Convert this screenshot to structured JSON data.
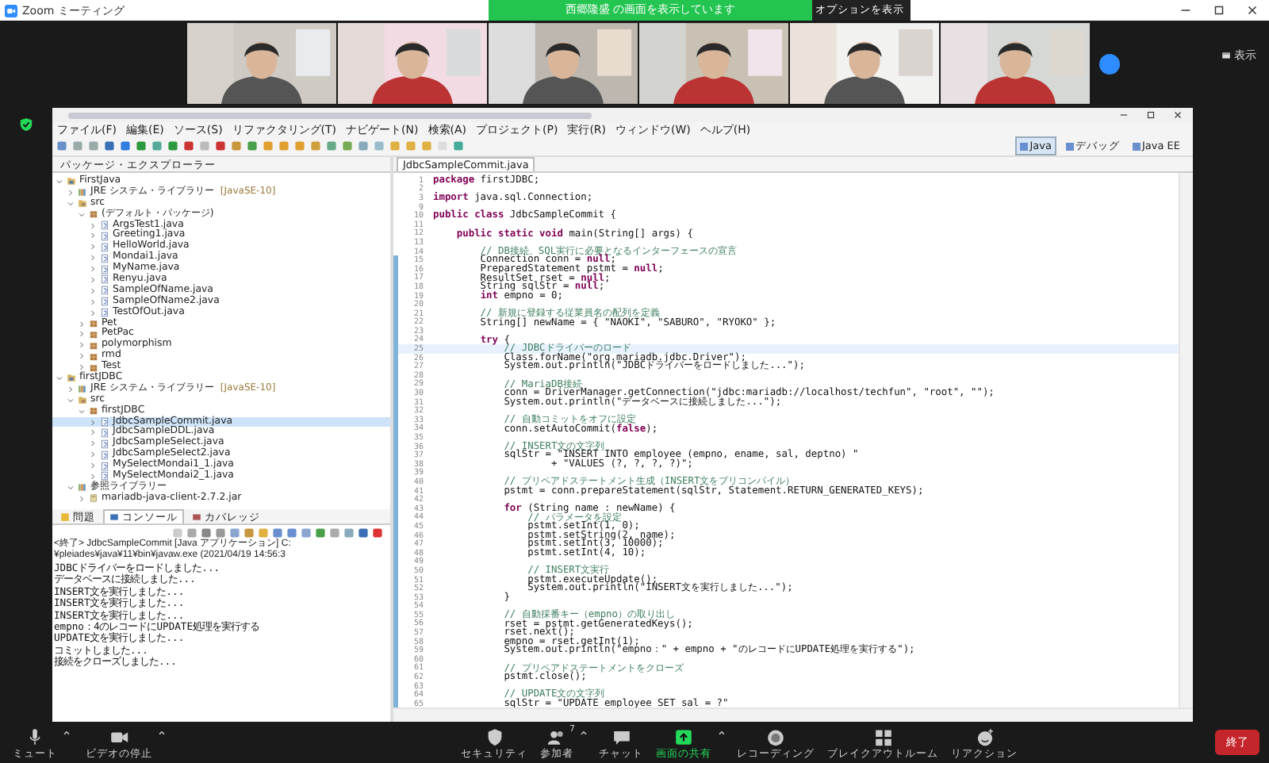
{
  "zoom_window": {
    "title": "Zoom ミーティング"
  },
  "share_banner": {
    "text": "西郷隆盛 の画面を表示しています",
    "options": "オプションを表示"
  },
  "view_button": "表示",
  "eclipse": {
    "menu": [
      "ファイル(F)",
      "編集(E)",
      "ソース(S)",
      "リファクタリング(T)",
      "ナビゲート(N)",
      "検索(A)",
      "プロジェクト(P)",
      "実行(R)",
      "ウィンドウ(W)",
      "ヘルプ(H)"
    ],
    "perspectives": [
      {
        "label": "Java",
        "selected": true
      },
      {
        "label": "デバッグ",
        "selected": false
      },
      {
        "label": "Java EE",
        "selected": false
      }
    ],
    "explorer": {
      "title": "パッケージ・エクスプローラー",
      "tree": [
        {
          "label": "FirstJava",
          "kind": "project",
          "expanded": true,
          "selected": false,
          "children": [
            {
              "label": "JRE システム・ライブラリー [JavaSE-10]",
              "kind": "library",
              "expanded": false,
              "selected": false
            },
            {
              "label": "src",
              "kind": "source",
              "expanded": true,
              "selected": false,
              "children": [
                {
                  "label": "(デフォルト・パッケージ)",
                  "kind": "package",
                  "expanded": true,
                  "selected": false,
                  "children": [
                    {
                      "label": "ArgsTest1.java",
                      "kind": "file",
                      "expanded": false,
                      "selected": false
                    },
                    {
                      "label": "Greeting1.java",
                      "kind": "file",
                      "expanded": false,
                      "selected": false
                    },
                    {
                      "label": "HelloWorld.java",
                      "kind": "file",
                      "expanded": false,
                      "selected": false
                    },
                    {
                      "label": "Mondai1.java",
                      "kind": "file",
                      "expanded": false,
                      "selected": false
                    },
                    {
                      "label": "MyName.java",
                      "kind": "file",
                      "expanded": false,
                      "selected": false
                    },
                    {
                      "label": "Renyu.java",
                      "kind": "file",
                      "expanded": false,
                      "selected": false
                    },
                    {
                      "label": "SampleOfName.java",
                      "kind": "file",
                      "expanded": false,
                      "selected": false
                    },
                    {
                      "label": "SampleOfName2.java",
                      "kind": "file",
                      "expanded": false,
                      "selected": false
                    },
                    {
                      "label": "TestOfOut.java",
                      "kind": "file",
                      "expanded": false,
                      "selected": false
                    }
                  ]
                },
                {
                  "label": "Pet",
                  "kind": "package",
                  "expanded": false,
                  "selected": false
                },
                {
                  "label": "PetPac",
                  "kind": "package",
                  "expanded": false,
                  "selected": false
                },
                {
                  "label": "polymorphism",
                  "kind": "package",
                  "expanded": false,
                  "selected": false
                },
                {
                  "label": "rmd",
                  "kind": "package",
                  "expanded": false,
                  "selected": false
                },
                {
                  "label": "Test",
                  "kind": "package",
                  "expanded": false,
                  "selected": false
                }
              ]
            }
          ]
        },
        {
          "label": "firstJDBC",
          "kind": "project",
          "expanded": true,
          "selected": false,
          "children": [
            {
              "label": "JRE システム・ライブラリー [JavaSE-10]",
              "kind": "library",
              "expanded": false,
              "selected": false
            },
            {
              "label": "src",
              "kind": "source",
              "expanded": true,
              "selected": false,
              "children": [
                {
                  "label": "firstJDBC",
                  "kind": "package",
                  "expanded": true,
                  "selected": false,
                  "children": [
                    {
                      "label": "JdbcSampleCommit.java",
                      "kind": "file",
                      "expanded": false,
                      "selected": true
                    },
                    {
                      "label": "JdbcSampleDDL.java",
                      "kind": "file",
                      "expanded": false,
                      "selected": false
                    },
                    {
                      "label": "JdbcSampleSelect.java",
                      "kind": "file",
                      "expanded": false,
                      "selected": false
                    },
                    {
                      "label": "JdbcSampleSelect2.java",
                      "kind": "file",
                      "expanded": false,
                      "selected": false
                    },
                    {
                      "label": "MySelectMondai1_1.java",
                      "kind": "file",
                      "expanded": false,
                      "selected": false
                    },
                    {
                      "label": "MySelectMondai2_1.java",
                      "kind": "file",
                      "expanded": false,
                      "selected": false
                    }
                  ]
                }
              ]
            },
            {
              "label": "参照ライブラリー",
              "kind": "library",
              "expanded": true,
              "selected": false,
              "children": [
                {
                  "label": "mariadb-java-client-2.7.2.jar",
                  "kind": "jar",
                  "expanded": false,
                  "selected": false
                }
              ]
            }
          ]
        }
      ]
    },
    "console": {
      "tabs": [
        {
          "label": "問題",
          "selected": false
        },
        {
          "label": "コンソール",
          "selected": true
        },
        {
          "label": "カバレッジ",
          "selected": false
        }
      ],
      "header": "<終了> JdbcSampleCommit [Java アプリケーション] C:¥pleiades¥java¥11¥bin¥javaw.exe (2021/04/19 14:56:3",
      "lines": [
        "JDBCドライバーをロードしました...",
        "データベースに接続しました...",
        "INSERT文を実行しました...",
        "INSERT文を実行しました...",
        "INSERT文を実行しました...",
        "empno：4のレコードにUPDATE処理を実行する",
        "UPDATE文を実行しました...",
        "コミットしました...",
        "接続をクローズしました..."
      ]
    },
    "editor": {
      "tab": "JdbcSampleCommit.java",
      "lines": [
        {
          "number": "1",
          "text": "**package** firstJDBC;",
          "kind": "code",
          "current": false
        },
        {
          "number": "2",
          "kind": "code",
          "current": false
        },
        {
          "number": "3",
          "text": "**import** java.sql.Connection;",
          "kind": "code",
          "current": false
        },
        {
          "number": "9",
          "kind": "code",
          "current": false
        },
        {
          "number": "10",
          "text": "**public class** JdbcSampleCommit {",
          "kind": "code",
          "current": false
        },
        {
          "number": "11",
          "kind": "code",
          "current": false
        },
        {
          "number": "12",
          "text": "    **public static void** main(String[] args) {",
          "kind": "code",
          "current": false
        },
        {
          "number": "13",
          "kind": "code",
          "current": false
        },
        {
          "number": "14",
          "text": "        // DB接続、SQL実行に必要となるインターフェースの宣言",
          "kind": "comment",
          "current": false
        },
        {
          "number": "15",
          "text": "        Connection conn = **null**;",
          "kind": "code",
          "current": false
        },
        {
          "number": "16",
          "text": "        PreparedStatement pstmt = **null**;",
          "kind": "code",
          "current": false
        },
        {
          "number": "17",
          "text": "        ResultSet rset = **null**;",
          "kind": "code",
          "current": false
        },
        {
          "number": "18",
          "text": "        String sqlStr = **null**;",
          "kind": "code",
          "current": false
        },
        {
          "number": "19",
          "text": "        **int** empno = 0;",
          "kind": "code",
          "current": false
        },
        {
          "number": "20",
          "kind": "code",
          "current": false
        },
        {
          "number": "21",
          "text": "        // 新規に登録する従業員名の配列を定義",
          "kind": "comment",
          "current": false
        },
        {
          "number": "22",
          "text": "        String[] newName = { \"NAOKI\", \"SABURO\", \"RYOKO\" };",
          "kind": "code",
          "current": false
        },
        {
          "number": "23",
          "kind": "code",
          "current": false
        },
        {
          "number": "24",
          "text": "        **try** {",
          "kind": "code",
          "current": false
        },
        {
          "number": "25",
          "text": "            // JDBCドライバーのロード",
          "kind": "comment",
          "current": true
        },
        {
          "number": "26",
          "text": "            Class.forName(\"org.mariadb.jdbc.Driver\");",
          "kind": "code",
          "current": false
        },
        {
          "number": "27",
          "text": "            System.out.println(\"JDBCドライバーをロードしました...\");",
          "kind": "code",
          "current": false
        },
        {
          "number": "28",
          "kind": "code",
          "current": false
        },
        {
          "number": "29",
          "text": "            // MariaDB接続",
          "kind": "comment",
          "current": false
        },
        {
          "number": "30",
          "text": "            conn = DriverManager.getConnection(\"jdbc:mariadb://localhost/techfun\", \"root\", \"\");",
          "kind": "code",
          "current": false
        },
        {
          "number": "31",
          "text": "            System.out.println(\"データベースに接続しました...\");",
          "kind": "code",
          "current": false
        },
        {
          "number": "32",
          "kind": "code",
          "current": false
        },
        {
          "number": "33",
          "text": "            // 自動コミットをオフに設定",
          "kind": "comment",
          "current": false
        },
        {
          "number": "34",
          "text": "            conn.setAutoCommit(**false**);",
          "kind": "code",
          "current": false
        },
        {
          "number": "35",
          "kind": "code",
          "current": false
        },
        {
          "number": "36",
          "text": "            // INSERT文の文字列",
          "kind": "comment",
          "current": false
        },
        {
          "number": "37",
          "text": "            sqlStr = \"INSERT INTO employee (empno, ename, sal, deptno) \"",
          "kind": "code",
          "current": false
        },
        {
          "number": "38",
          "text": "                    + \"VALUES (?, ?, ?, ?)\";",
          "kind": "code",
          "current": false
        },
        {
          "number": "39",
          "kind": "code",
          "current": false
        },
        {
          "number": "40",
          "text": "            // プリペアドステートメント生成（INSERT文をプリコンパイル）",
          "kind": "comment",
          "current": false
        },
        {
          "number": "41",
          "text": "            pstmt = conn.prepareStatement(sqlStr, Statement.RETURN_GENERATED_KEYS);",
          "kind": "code",
          "current": false
        },
        {
          "number": "42",
          "kind": "code",
          "current": false
        },
        {
          "number": "43",
          "text": "            **for** (String name : newName) {",
          "kind": "code",
          "current": false
        },
        {
          "number": "44",
          "text": "                // パラメータを設定",
          "kind": "comment",
          "current": false
        },
        {
          "number": "45",
          "text": "                pstmt.setInt(1, 0);",
          "kind": "code",
          "current": false
        },
        {
          "number": "46",
          "text": "                pstmt.setString(2, name);",
          "kind": "code",
          "current": false
        },
        {
          "number": "47",
          "text": "                pstmt.setInt(3, 10000);",
          "kind": "code",
          "current": false
        },
        {
          "number": "48",
          "text": "                pstmt.setInt(4, 10);",
          "kind": "code",
          "current": false
        },
        {
          "number": "49",
          "kind": "code",
          "current": false
        },
        {
          "number": "50",
          "text": "                // INSERT文実行",
          "kind": "comment",
          "current": false
        },
        {
          "number": "51",
          "text": "                pstmt.executeUpdate();",
          "kind": "code",
          "current": false
        },
        {
          "number": "52",
          "text": "                System.out.println(\"INSERT文を実行しました...\");",
          "kind": "code",
          "current": false
        },
        {
          "number": "53",
          "text": "            }",
          "kind": "code",
          "current": false
        },
        {
          "number": "54",
          "kind": "code",
          "current": false
        },
        {
          "number": "55",
          "text": "            // 自動採番キー（empno）の取り出し",
          "kind": "comment",
          "current": false
        },
        {
          "number": "56",
          "text": "            rset = pstmt.getGeneratedKeys();",
          "kind": "code",
          "current": false
        },
        {
          "number": "57",
          "text": "            rset.next();",
          "kind": "code",
          "current": false
        },
        {
          "number": "58",
          "text": "            empno = rset.getInt(1);",
          "kind": "code",
          "current": false
        },
        {
          "number": "59",
          "text": "            System.out.println(\"empno：\" + empno + \"のレコードにUPDATE処理を実行する\");",
          "kind": "code",
          "current": false
        },
        {
          "number": "60",
          "kind": "code",
          "current": false
        },
        {
          "number": "61",
          "text": "            // プリペアドステートメントをクローズ",
          "kind": "comment",
          "current": false
        },
        {
          "number": "62",
          "text": "            pstmt.close();",
          "kind": "code",
          "current": false
        },
        {
          "number": "63",
          "kind": "code",
          "current": false
        },
        {
          "number": "64",
          "text": "            // UPDATE文の文字列",
          "kind": "comment",
          "current": false
        },
        {
          "number": "65",
          "text": "            sqlStr = \"UPDATE employee SET sal = ?\"",
          "kind": "code",
          "current": false
        }
      ]
    }
  },
  "toolbar": {
    "buttons": [
      {
        "label": "ミュート",
        "kind": "mic",
        "has_menu": true
      },
      {
        "label": "ビデオの停止",
        "kind": "video",
        "has_menu": true
      },
      {
        "label": "セキュリティ",
        "kind": "shield",
        "has_menu": false
      },
      {
        "label": "参加者",
        "kind": "people",
        "has_menu": true,
        "badge": "7"
      },
      {
        "label": "チャット",
        "kind": "chat",
        "has_menu": false
      },
      {
        "label": "画面の共有",
        "kind": "share",
        "has_menu": true
      },
      {
        "label": "レコーディング",
        "kind": "record",
        "has_menu": false
      },
      {
        "label": "ブレイクアウトルーム",
        "kind": "breakout",
        "has_menu": false
      },
      {
        "label": "リアクション",
        "kind": "reaction",
        "has_menu": false
      }
    ],
    "end": "終了"
  }
}
